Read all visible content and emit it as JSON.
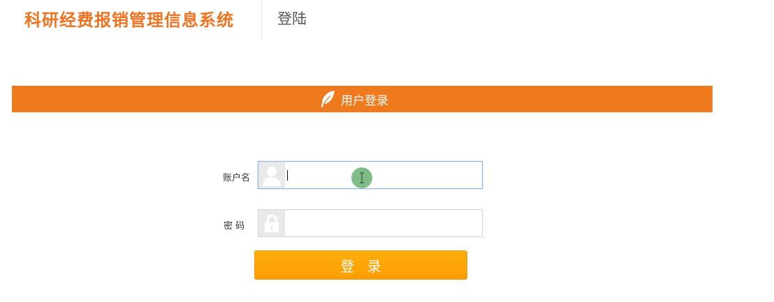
{
  "header": {
    "system_title": "科研经费报销管理信息系统",
    "page_label": "登陆"
  },
  "banner": {
    "title": "用户登录",
    "icon": "feather-icon"
  },
  "form": {
    "username_label": "账户名",
    "username_value": "",
    "username_icon": "user-icon",
    "password_label": "密 码",
    "password_value": "",
    "password_icon": "lock-icon",
    "submit_label": "登 录"
  },
  "colors": {
    "brand_orange": "#ee7320",
    "banner_orange": "#ef7a1e",
    "button_orange": "#ffa308",
    "focus_border": "#8fb2ea"
  }
}
